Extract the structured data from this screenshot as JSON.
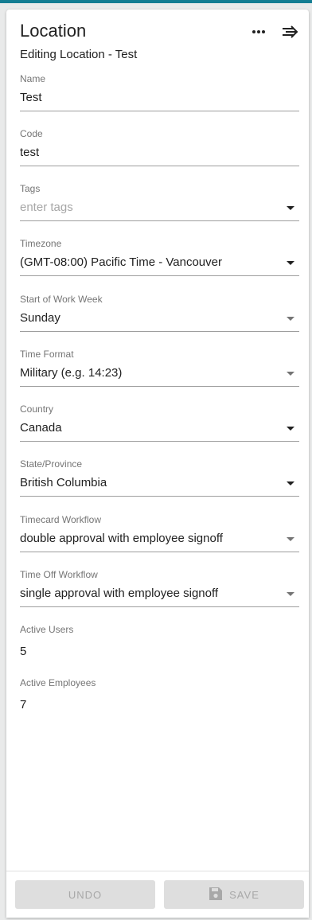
{
  "header": {
    "title": "Location",
    "subtitle": "Editing Location - Test"
  },
  "fields": {
    "name": {
      "label": "Name",
      "value": "Test"
    },
    "code": {
      "label": "Code",
      "value": "test"
    },
    "tags": {
      "label": "Tags",
      "placeholder": "enter tags"
    },
    "timezone": {
      "label": "Timezone",
      "value": "(GMT-08:00) Pacific Time - Vancouver"
    },
    "week_start": {
      "label": "Start of Work Week",
      "value": "Sunday"
    },
    "time_format": {
      "label": "Time Format",
      "value": "Military (e.g. 14:23)"
    },
    "country": {
      "label": "Country",
      "value": "Canada"
    },
    "state": {
      "label": "State/Province",
      "value": "British Columbia"
    },
    "timecard_workflow": {
      "label": "Timecard Workflow",
      "value": "double approval with employee signoff"
    },
    "timeoff_workflow": {
      "label": "Time Off Workflow",
      "value": "single approval with employee signoff"
    },
    "active_users": {
      "label": "Active Users",
      "value": "5"
    },
    "active_employees": {
      "label": "Active Employees",
      "value": "7"
    }
  },
  "footer": {
    "undo_label": "UNDO",
    "save_label": "SAVE"
  },
  "icons": {
    "more": "more-horizontal-icon",
    "collapse": "arrow-collapse-right-icon",
    "save": "floppy-disk-icon"
  },
  "colors": {
    "accent_bar": "#147d92",
    "disabled_button": "#dedede",
    "disabled_text": "#a8a8a8"
  }
}
